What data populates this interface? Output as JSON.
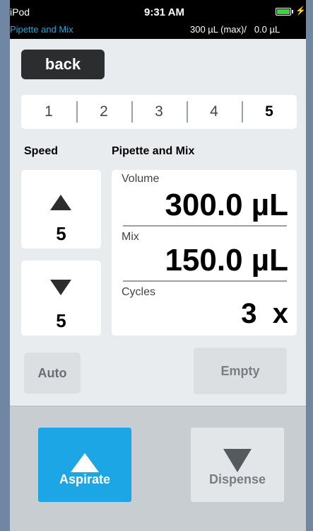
{
  "status_bar": {
    "carrier": "iPod",
    "time": "9:31 AM",
    "mode": "Pipette and Mix",
    "volume_info": "300 µL (max)/   0.0 µL",
    "charging_symbol": "⚡"
  },
  "nav": {
    "back_label": "back"
  },
  "steps": [
    "1",
    "2",
    "3",
    "4",
    "5"
  ],
  "speed": {
    "label": "Speed",
    "aspirate_value": "5",
    "dispense_value": "5"
  },
  "pipette_mix": {
    "title": "Pipette and Mix",
    "volume_label": "Volume",
    "volume_value": "300.0 µL",
    "mix_label": "Mix",
    "mix_value": "150.0 µL",
    "cycles_label": "Cycles",
    "cycles_value": "3  x"
  },
  "buttons": {
    "auto": "Auto",
    "empty": "Empty",
    "aspirate": "Aspirate",
    "dispense": "Dispense"
  },
  "colors": {
    "accent": "#1da6e6",
    "battery": "#3ed23e"
  }
}
